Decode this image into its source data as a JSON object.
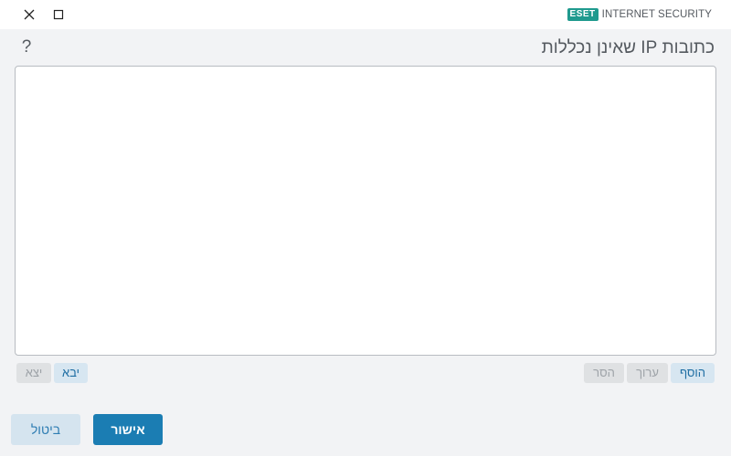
{
  "window": {
    "brand_logo": "ESET",
    "product_name": "INTERNET SECURITY",
    "close_icon": "close-icon",
    "maximize_icon": "maximize-icon"
  },
  "header": {
    "help_label": "?",
    "title": "כתובות IP שאינן נכללות"
  },
  "list": {
    "items": []
  },
  "toolbar": {
    "add_label": "הוסף",
    "edit_label": "ערוך",
    "remove_label": "הסר",
    "import_label": "יבא",
    "export_label": "יצא"
  },
  "footer": {
    "ok_label": "אישור",
    "cancel_label": "ביטול"
  },
  "colors": {
    "accent": "#1b7db3",
    "brand": "#1f9a8e",
    "background": "#f2f3f5"
  }
}
